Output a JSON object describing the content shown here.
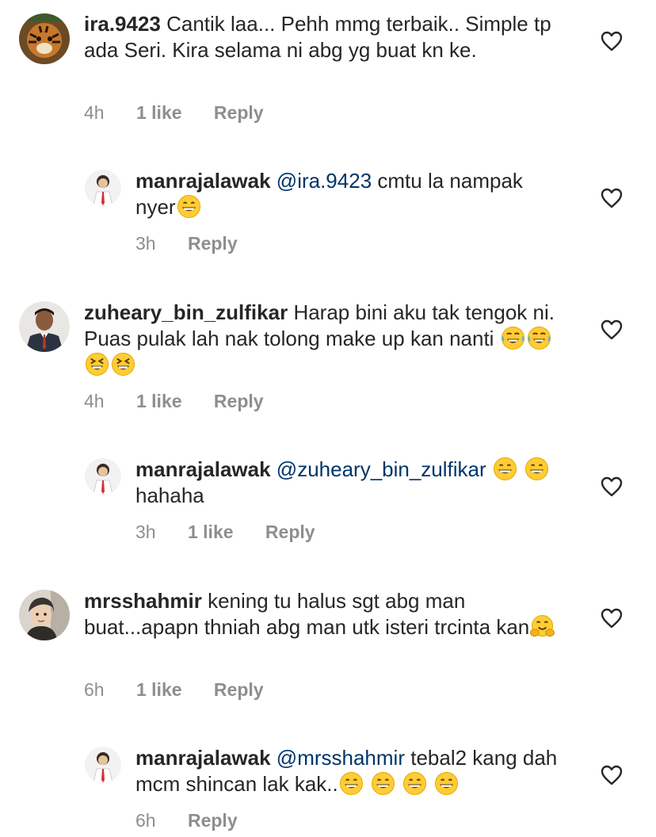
{
  "comments": [
    {
      "username": "ira.9423",
      "mention": "",
      "text": "Cantik laa... Pehh mmg terbaik.. Simple tp ada Seri. Kira selama ni abg yg buat kn ke.",
      "time": "4h",
      "likes": "1 like",
      "reply_label": "Reply",
      "avatar": "tiger-avatar",
      "emojis": []
    },
    {
      "username": "manrajalawak",
      "mention": "@ira.9423",
      "text": "cmtu la nampak nyer",
      "time": "3h",
      "likes": "",
      "reply_label": "Reply",
      "avatar": "man-avatar",
      "emojis": [
        "grinning-face"
      ]
    },
    {
      "username": "zuheary_bin_zulfikar",
      "mention": "",
      "text": "Harap bini aku tak tengok ni. Puas pulak lah nak tolong make up kan nanti",
      "time": "4h",
      "likes": "1 like",
      "reply_label": "Reply",
      "avatar": "man-portrait-avatar",
      "emojis": [
        "tears-of-joy",
        "tears-of-joy",
        "squinting-laugh",
        "squinting-laugh"
      ]
    },
    {
      "username": "manrajalawak",
      "mention": "@zuheary_bin_zulfikar",
      "text": "hahaha",
      "time": "3h",
      "likes": "1 like",
      "reply_label": "Reply",
      "avatar": "man-avatar",
      "emojis": [
        "grinning-face",
        "grinning-face"
      ]
    },
    {
      "username": "mrsshahmir",
      "mention": "",
      "text": "kening tu halus sgt abg man buat...apapn thniah abg man utk isteri trcinta kan",
      "time": "6h",
      "likes": "1 like",
      "reply_label": "Reply",
      "avatar": "woman-avatar",
      "emojis": [
        "hugging-face"
      ]
    },
    {
      "username": "manrajalawak",
      "mention": "@mrsshahmir",
      "text": "tebal2 kang dah mcm shincan lak kak..",
      "time": "6h",
      "likes": "",
      "reply_label": "Reply",
      "avatar": "man-avatar",
      "emojis": [
        "grinning-face",
        "grinning-face",
        "grinning-face",
        "grinning-face"
      ]
    }
  ],
  "icons": {
    "like": "heart-outline-icon"
  },
  "colors": {
    "text": "#262626",
    "mention": "#003569",
    "meta": "#8e8e8e"
  }
}
